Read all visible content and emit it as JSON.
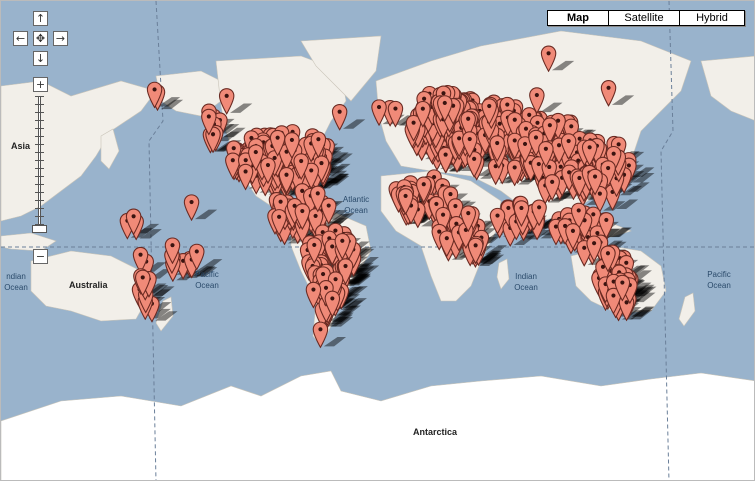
{
  "map_types": {
    "map": "Map",
    "satellite": "Satellite",
    "hybrid": "Hybrid",
    "active": "map"
  },
  "controls": {
    "pan_up": "↑",
    "pan_left": "←",
    "pan_center": "✥",
    "pan_right": "→",
    "pan_down": "↓",
    "zoom_in": "+",
    "zoom_out": "−"
  },
  "labels": {
    "atlantic": "Atlantic\nOcean",
    "pacific_west": "Pacific\nOcean",
    "pacific_east": "Pacific\nOcean",
    "indian": "Indian\nOcean",
    "indian_west": "ndian\nOcean",
    "australia": "Australia",
    "antarctica": "Antarctica",
    "asia": "Asia"
  },
  "colors": {
    "water": "#99b3cc",
    "land": "#f2efe9",
    "ice": "#ffffff",
    "marker": "#f08a78",
    "marker_outline": "#6a2a22",
    "dateline": "#6a7f99"
  },
  "marker_icon": "map-pin-icon"
}
